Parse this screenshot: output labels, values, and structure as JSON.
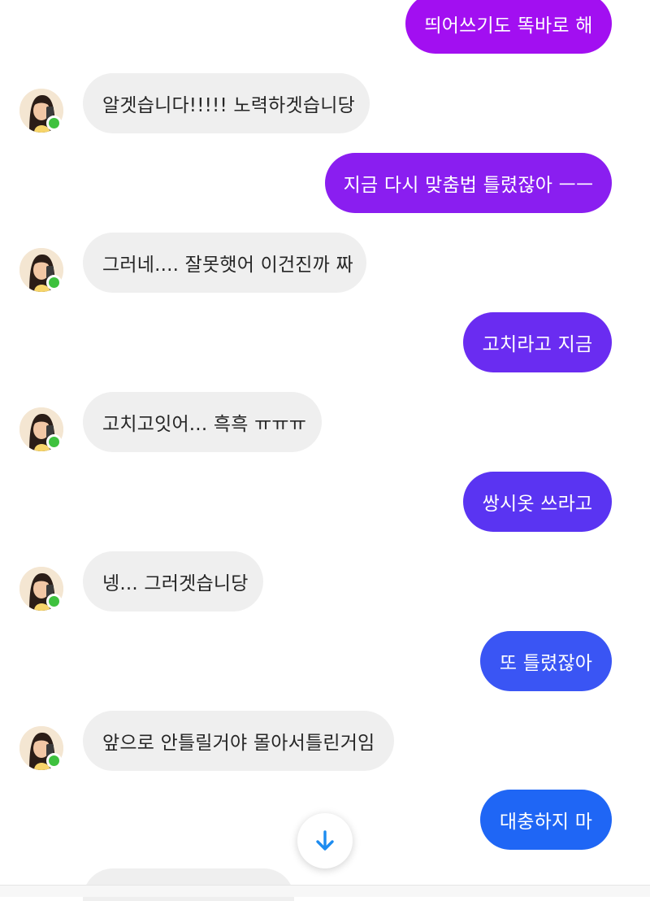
{
  "messages": [
    {
      "side": "sent",
      "text": "띄어쓰기도 똑바로 해"
    },
    {
      "side": "received",
      "text": "알겟습니다!!!!! 노력하겟습니당"
    },
    {
      "side": "sent",
      "text": "지금 다시 맞춤법 틀렸잖아 ㅡㅡ"
    },
    {
      "side": "received",
      "text": "그러네.... 잘못햇어 이건진까 짜"
    },
    {
      "side": "sent",
      "text": "고치라고 지금"
    },
    {
      "side": "received",
      "text": "고치고잇어... 흑흑 ㅠㅠㅠ"
    },
    {
      "side": "sent",
      "text": "쌍시옷 쓰라고"
    },
    {
      "side": "received",
      "text": "넹... 그러겟습니당"
    },
    {
      "side": "sent",
      "text": "또 틀렸잖아"
    },
    {
      "side": "received",
      "text": "앞으로 안틀릴거야 몰아서틀린거임"
    },
    {
      "side": "sent",
      "text": "대충하지 마"
    }
  ],
  "colors": {
    "sent_gradient": [
      "#a20ff1",
      "#8a1ef0",
      "#5a34f2",
      "#3a55f4",
      "#1f66f5"
    ],
    "received_bg": "#efefef",
    "online_dot": "#3ec13e"
  },
  "icons": {
    "scroll_down": "arrow-down-icon",
    "presence": "online-dot-icon"
  }
}
